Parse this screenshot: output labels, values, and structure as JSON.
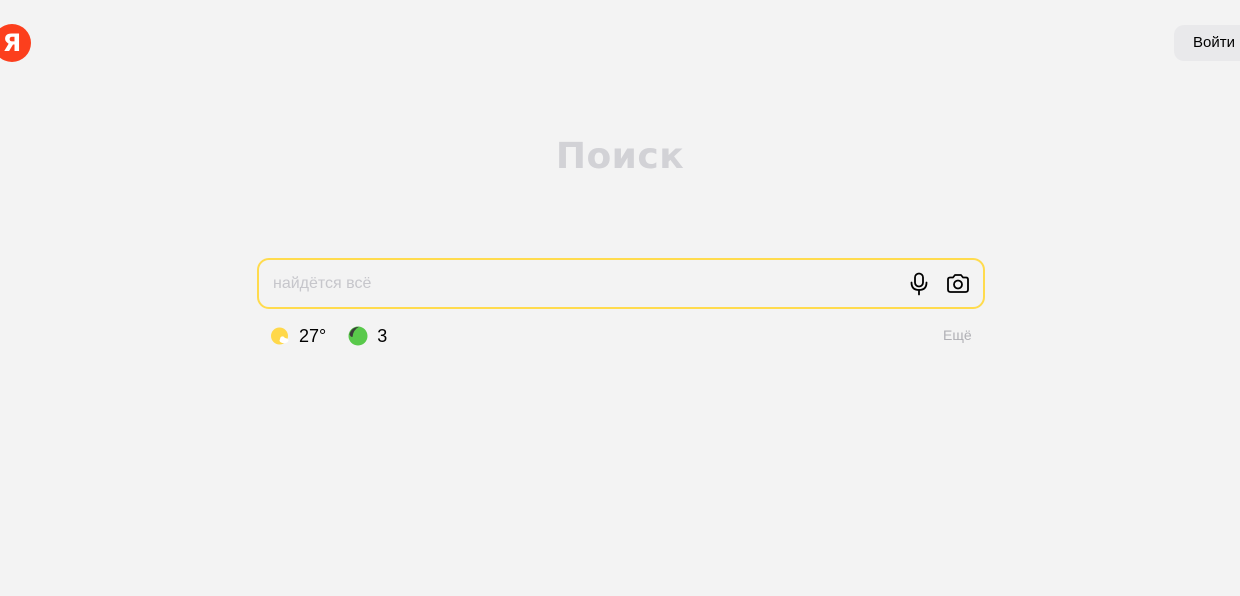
{
  "header": {
    "logo_letter": "Я",
    "login_label": "Войти"
  },
  "main": {
    "title": "Поиск"
  },
  "search": {
    "placeholder": "найдётся всё",
    "value": ""
  },
  "widgets": {
    "weather": {
      "icon": "sun-cloud-icon",
      "temperature": "27°"
    },
    "traffic": {
      "icon": "traffic-ball-icon",
      "level": "3"
    },
    "more_label": "Ещё"
  },
  "colors": {
    "brand_red": "#fc3f1d",
    "search_border": "#ffdb4d",
    "background": "#f3f3f3",
    "traffic_green": "#59c94b"
  }
}
